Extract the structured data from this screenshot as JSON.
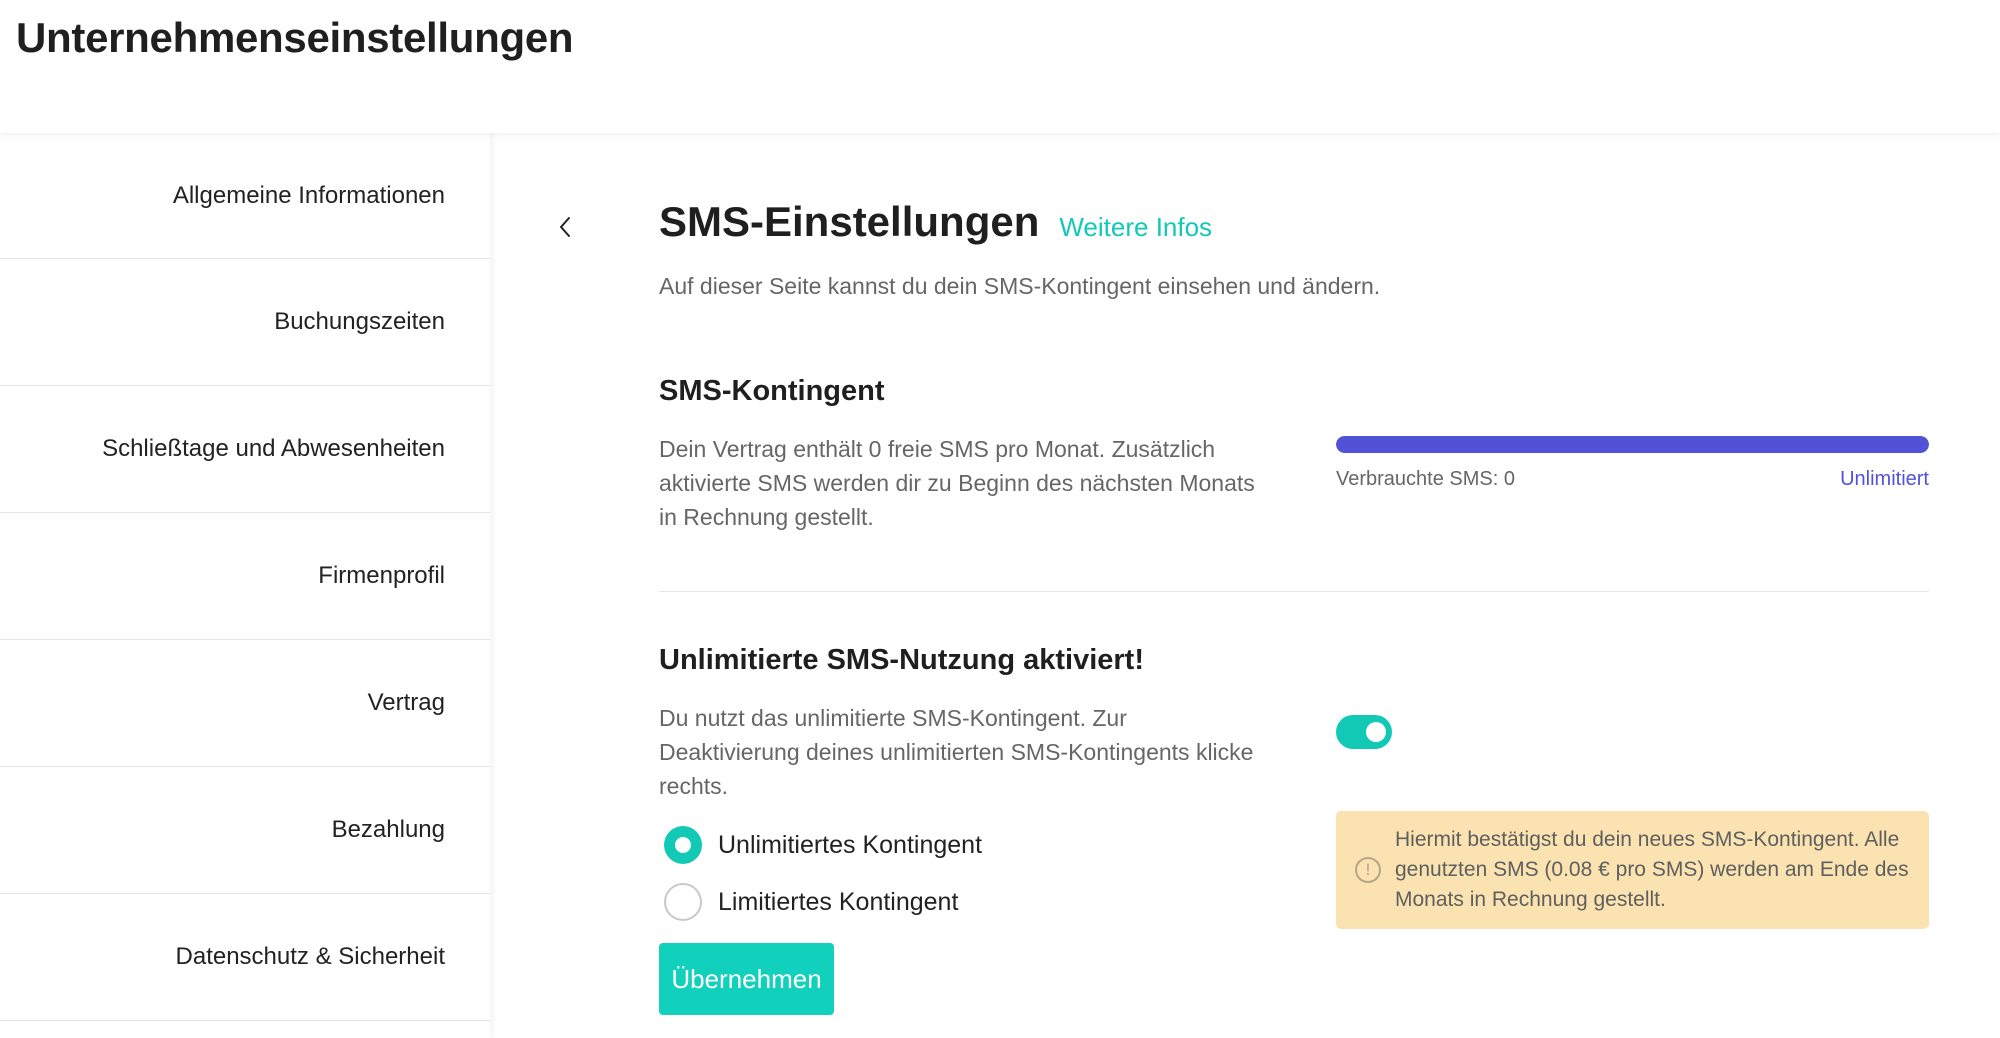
{
  "header": {
    "title": "Unternehmenseinstellungen"
  },
  "sidebar": {
    "items": [
      {
        "label": "Allgemeine Informationen"
      },
      {
        "label": "Buchungszeiten"
      },
      {
        "label": "Schließtage und Abwesenheiten"
      },
      {
        "label": "Firmenprofil"
      },
      {
        "label": "Vertrag"
      },
      {
        "label": "Bezahlung"
      },
      {
        "label": "Datenschutz & Sicherheit"
      }
    ]
  },
  "main": {
    "back_icon": "chevron-left-icon",
    "title": "SMS-Einstellungen",
    "more_info_link": "Weitere Infos",
    "subtitle": "Auf dieser Seite kannst du dein SMS-Kontingent einsehen und ändern.",
    "quota": {
      "title": "SMS-Kontingent",
      "description": "Dein Vertrag enthält 0 freie SMS pro Monat. Zusätzlich aktivierte SMS werden dir zu Beginn des nächsten Monats in Rechnung gestellt.",
      "used_label": "Verbrauchte SMS: 0",
      "limit_label": "Unlimitiert",
      "progress_fill_fraction": 1.0
    },
    "unlimited": {
      "title": "Unlimitierte SMS-Nutzung aktiviert!",
      "description": "Du nutzt das unlimitierte SMS-Kontingent. Zur Deaktivierung deines unlimitierten SMS-Kontingents klicke rechts.",
      "toggle_on": true,
      "options": [
        {
          "label": "Unlimitiertes Kontingent",
          "checked": true
        },
        {
          "label": "Limitiertes Kontingent",
          "checked": false
        }
      ],
      "apply_button": "Übernehmen",
      "warning_icon": "exclamation-circle-icon",
      "warning_text": "Hiermit bestätigst du dein neues SMS-Kontingent. Alle genutzten SMS (0.08 € pro SMS) werden am Ende des Monats in Rechnung gestellt."
    }
  },
  "colors": {
    "accent": "#12c9b5",
    "progress": "#5152d5",
    "warning_bg": "#fae3b0"
  }
}
